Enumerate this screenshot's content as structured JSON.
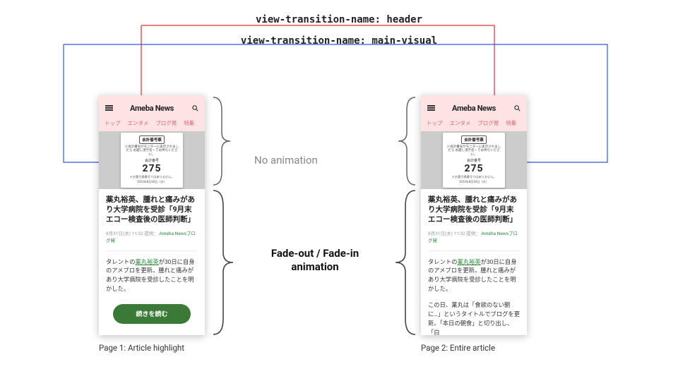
{
  "labels": {
    "header_name": "view-transition-name: header",
    "main_visual_name": "view-transition-name: main-visual"
  },
  "annotations": {
    "no_animation": "No animation",
    "fade": "Fade-out / Fade-in animation"
  },
  "captions": {
    "page1": "Page 1: Article highlight",
    "page2": "Page 2: Entire article"
  },
  "shared": {
    "brand": "Ameba News",
    "tabs": [
      "トップ",
      "エンタメ",
      "ブログ発",
      "特集"
    ],
    "ticket": {
      "title": "会計番号票",
      "sub": "※会計番号がモニターに表示されましたら\nお越し頂き窓・でお待ちください。",
      "row_label": "会計番号",
      "number": "275",
      "note": "※お薬引換番号ではありません。",
      "date": "2023年8月30日（水）"
    },
    "headline": "薬丸裕英、腫れと痛みがあり大学病院を受診「9月末エコー検査後の医師判断」",
    "meta_time": "8月31日(木) 11:32",
    "meta_provider_label": "提供：",
    "meta_provider": "Ameba Newsブログ発",
    "lead_pre": "タレントの",
    "lead_link": "薬丸裕英",
    "lead_post": "が30日に自身のアメブロを更新。腫れと痛みがあり大学病院を受診したことを明かした。"
  },
  "page1": {
    "cta": "続きを読む"
  },
  "page2": {
    "para2": "この日、薬丸は「食欲のない朝に…」というタイトルでブログを更新。「本日の朝食」と切り出し、「白"
  }
}
